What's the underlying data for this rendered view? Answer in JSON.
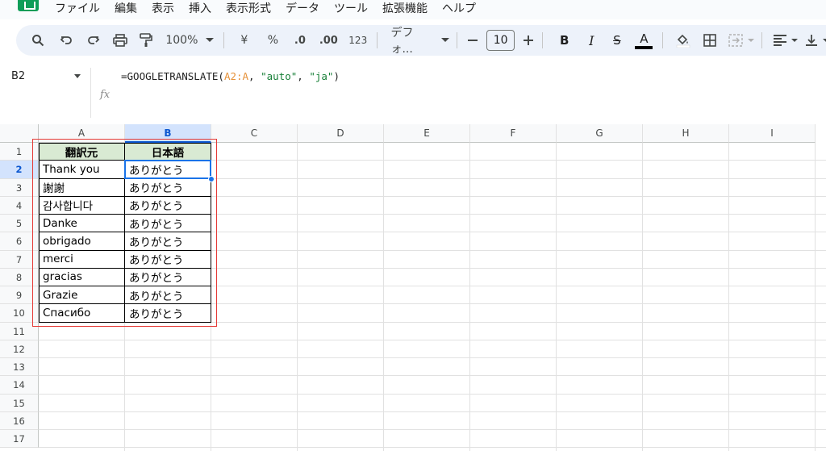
{
  "menu": [
    "ファイル",
    "編集",
    "表示",
    "挿入",
    "表示形式",
    "データ",
    "ツール",
    "拡張機能",
    "ヘルプ"
  ],
  "toolbar": {
    "zoom": "100%",
    "currency": "¥",
    "percent": "%",
    "dec_decrease": ".0",
    "dec_increase": ".00",
    "number_format": "123",
    "font": "デフォ...",
    "font_size": "10",
    "bold": "B",
    "italic": "I",
    "strike": "S",
    "text_color": "A"
  },
  "formula_bar": {
    "name_box": "B2",
    "fx": "fx",
    "formula_prefix": "=GOOGLETRANSLATE(",
    "formula_range": "A2:A",
    "formula_sep1": ", ",
    "formula_arg1": "\"auto\"",
    "formula_sep2": ", ",
    "formula_arg2": "\"ja\"",
    "formula_suffix": ")"
  },
  "columns": [
    "A",
    "B",
    "C",
    "D",
    "E",
    "F",
    "G",
    "H",
    "I"
  ],
  "rows": [
    "1",
    "2",
    "3",
    "4",
    "5",
    "6",
    "7",
    "8",
    "9",
    "10",
    "11",
    "12",
    "13",
    "14",
    "15",
    "16",
    "17"
  ],
  "table": {
    "headers": [
      "翻訳元",
      "日本語"
    ],
    "rows": [
      [
        "Thank you",
        "ありがとう"
      ],
      [
        "謝謝",
        "ありがとう"
      ],
      [
        "감사합니다",
        "ありがとう"
      ],
      [
        "Danke",
        "ありがとう"
      ],
      [
        "obrigado",
        "ありがとう"
      ],
      [
        "merci",
        "ありがとう"
      ],
      [
        "gracias",
        "ありがとう"
      ],
      [
        "Grazie",
        "ありがとう"
      ],
      [
        "Спасибо",
        "ありがとう"
      ]
    ]
  },
  "colors": {
    "header_fill": "#d9ead3",
    "selection": "#1a73e8",
    "annotation": "#e53935",
    "formula_range": "#e69138",
    "formula_string": "#188038"
  }
}
